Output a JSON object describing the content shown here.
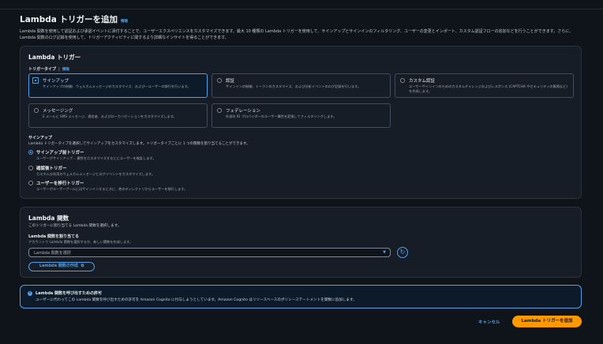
{
  "page": {
    "title": "Lambda トリガーを追加",
    "info": "情報",
    "description": "Lambda 関数を使用して認証および承認イベントに添付することで、ユーザーエクスペリエンスをカスタマイズできます。最大 10 種類の Lambda トリガーを使用して、サインアップとサインインのフィルタリング、ユーザーの変更とインポート、カスタム認証フローの追加などを行うことができます。さらに、Lambda 関数のログ記録を使用して、トリガーアクティビティに関するより詳細なインサイトを得ることができます。"
  },
  "trigger_panel": {
    "title": "Lambda トリガー",
    "type_label": "トリガータイプ",
    "info": "情報",
    "cards": [
      {
        "title": "サインアップ",
        "desc": "サインアップの制御、ウェルカムメッセージのカスタマイズ、および一ユーザーの移行を行います。",
        "selected": true
      },
      {
        "title": "認証",
        "desc": "サインインの制御、トークンのカスタマイズ、および分析イベントのログ記録を行います。",
        "selected": false
      },
      {
        "title": "カスタム認証",
        "desc": "ユーザーサインインのためのカスタムチャレンジおよびレスポンス (CAPTCHA やセキュリティの質問など) を作成します。",
        "selected": false
      },
      {
        "title": "メッセージング",
        "desc": "E メールと SMS メッセージ、通信者、およびローカリゼーションをカスタマイズします。",
        "selected": false
      },
      {
        "title": "フェデレーション",
        "desc": "外部の ID プロバイダーのユーザー属性を変換してフィルタリングします。",
        "selected": false
      }
    ],
    "signup": {
      "title": "サインアップ",
      "desc": "Lambda トリガータイプを選択してサインアップをカスタマイズします。トリガータイプごとに 1 つの関数を割り当てることができます。",
      "options": [
        {
          "title": "サインアップ前トリガー",
          "desc": "ユーザーがサインアップ… 属性をカスタマイズするとにユーザーを検証します。",
          "selected": true
        },
        {
          "title": "確認後トリガー",
          "desc": "カスタム分析用のウェルカムメッセージとログイベントをカスタマイズします。",
          "selected": false
        },
        {
          "title": "ユーザーを移行トリガー",
          "desc": "ユーザーがユーザープールにはサインインするときに、他のディレクトリからユーザーを移行します。",
          "selected": false
        }
      ]
    }
  },
  "function_panel": {
    "title": "Lambda 関数",
    "desc": "このトリガーに割り当てる Lambda 関数を選択します。",
    "assign_label": "Lambda 関数を割り当てる",
    "assign_desc": "アカウントで Lambda 関数を選択するか、新しい関数を作成します。",
    "select_placeholder": "Lambda 関数を選択",
    "create_button": "Lambda 関数の作成"
  },
  "alert": {
    "title": "Lambda 関数を呼び出すための許可",
    "text": "ユーザーに代わってこの Lambda 関数を呼び出すための許可を Amazon Cognito に付与しようとしています。Amazon Cognito はリソースベースのポリシーステートメントを関数に追加します。"
  },
  "footer": {
    "cancel": "キャンセル",
    "submit": "Lambda トリガーを追加"
  },
  "colors": {
    "background": "#0f141a",
    "panel": "#161d26",
    "accent": "#539fe5",
    "primary": "#ff9900"
  }
}
